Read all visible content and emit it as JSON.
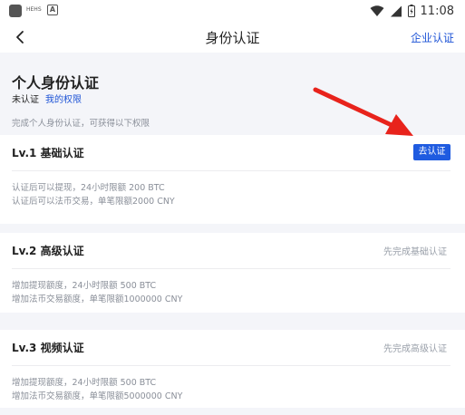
{
  "status_bar": {
    "time": "11:08",
    "tiny_text": "HEHS",
    "a_icon": "A"
  },
  "nav": {
    "title": "身份认证",
    "right_link": "企业认证"
  },
  "personal": {
    "title": "个人身份认证",
    "status": "未认证",
    "my_permissions": "我的权限",
    "description": "完成个人身份认证，可获得以下权限"
  },
  "levels": [
    {
      "title": "Lv.1 基础认证",
      "action": "去认证",
      "line1": "认证后可以提现，24小时限额 200 BTC",
      "line2": "认证后可以法币交易，单笔限额2000 CNY"
    },
    {
      "title": "Lv.2 高级认证",
      "action": "先完成基础认证",
      "line1": "增加提现额度，24小时限额 500 BTC",
      "line2": "增加法币交易额度，单笔限额1000000 CNY"
    },
    {
      "title": "Lv.3 视频认证",
      "action": "先完成高级认证",
      "line1": "增加提现额度，24小时限额 500 BTC",
      "line2": "增加法币交易额度，单笔限额5000000 CNY"
    }
  ],
  "colors": {
    "accent": "#1f5be0",
    "link": "#1e54d6",
    "arrow": "#e8231c"
  }
}
